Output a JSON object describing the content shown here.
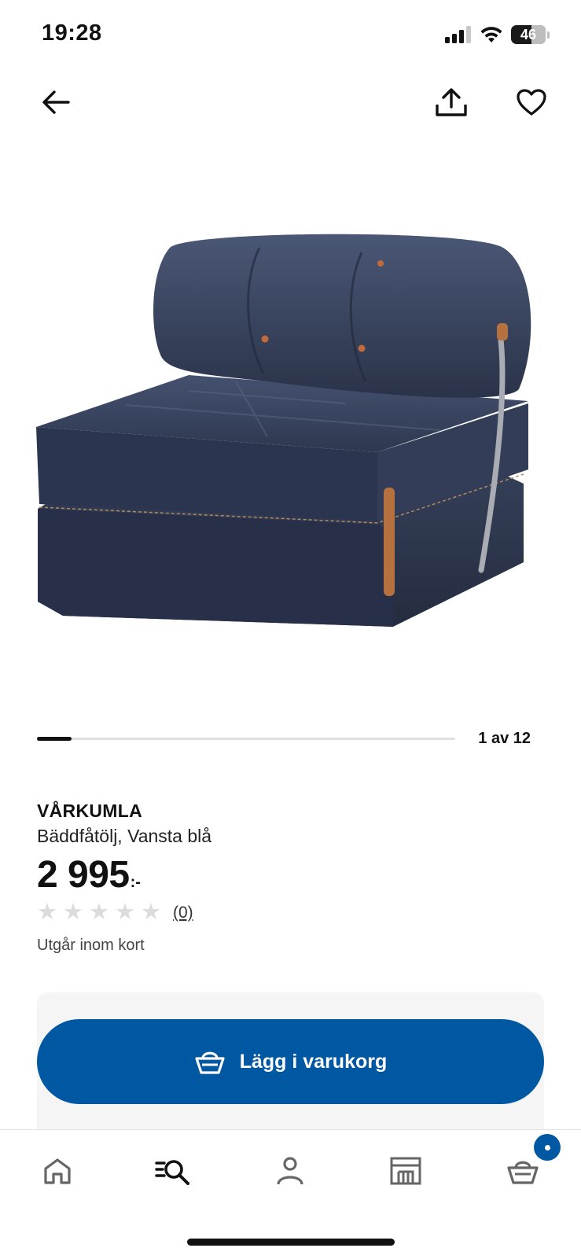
{
  "status_bar": {
    "time": "19:28",
    "battery": "46"
  },
  "product": {
    "name": "VÅRKUMLA",
    "description": "Bäddfåtölj, Vansta blå",
    "price": "2 995",
    "price_suffix": ":-",
    "rating": 0,
    "rating_max": 5,
    "review_count": "(0)",
    "stock_note": "Utgår inom kort",
    "image_alt": "armchair-bed-denim-image"
  },
  "carousel": {
    "label": "1 av 12",
    "current": 1,
    "total": 12
  },
  "actions": {
    "add_to_cart": "Lägg i varukorg"
  },
  "icons": {
    "back": "arrow-left-icon",
    "share": "share-icon",
    "favorite": "heart-icon",
    "basket": "basket-icon"
  },
  "tab_bar": {
    "items": [
      "home",
      "search",
      "profile",
      "store",
      "cart"
    ],
    "active": "search"
  },
  "colors": {
    "accent": "#0058a3",
    "text": "#111111",
    "star_empty": "#dcdcdc"
  }
}
